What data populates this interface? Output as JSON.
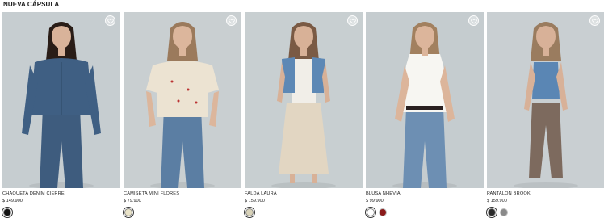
{
  "section": {
    "title": "NUEVA CÁPSULA"
  },
  "products": [
    {
      "name": "CHAQUETA DENIM CIERRE",
      "price": "$ 149.900",
      "image": {
        "bg": "#c6cdd0",
        "skin": "#d9b39a",
        "hair": "#2a1d17",
        "top": "#3f5f83",
        "bottom": "#3e5c7e",
        "top_style": "jacket",
        "bottom_style": "jeans"
      },
      "swatches": [
        {
          "color": "#111111",
          "selected": true
        }
      ]
    },
    {
      "name": "CAMISETA MINI FLORES",
      "price": "$ 79.900",
      "image": {
        "bg": "#c9cfd1",
        "skin": "#dcb69c",
        "hair": "#9b7a5c",
        "top": "#ece3d2",
        "bottom": "#5b7ea3",
        "top_style": "tee",
        "bottom_style": "jeans"
      },
      "swatches": [
        {
          "color": "#e9e3c8",
          "selected": true
        }
      ]
    },
    {
      "name": "FALDA LAURA",
      "price": "$ 159.900",
      "image": {
        "bg": "#c8cfd1",
        "skin": "#d8b197",
        "hair": "#7a5a44",
        "top": "#5d88b5",
        "bottom": "#e2d6c2",
        "top_style": "vest",
        "bottom_style": "skirt"
      },
      "swatches": [
        {
          "color": "#d8d2b8",
          "selected": true
        }
      ]
    },
    {
      "name": "BLUSA NHEVIA",
      "price": "$ 99.900",
      "image": {
        "bg": "#c5cccf",
        "skin": "#dcb59b",
        "hair": "#a2805f",
        "top": "#f7f6f2",
        "bottom": "#6d8fb3",
        "top_style": "sleeveless",
        "bottom_style": "jeans"
      },
      "swatches": [
        {
          "color": "#ffffff",
          "selected": true
        },
        {
          "color": "#8b1a1a",
          "selected": false
        }
      ]
    },
    {
      "name": "PANTALON BROOK",
      "price": "$ 159.900",
      "image": {
        "bg": "#c9cfd2",
        "skin": "#d8b198",
        "hair": "#9a7c5f",
        "top": "#5a86b4",
        "bottom": "#7d6a5e",
        "top_style": "tank",
        "bottom_style": "trousers"
      },
      "swatches": [
        {
          "color": "#2b2b2b",
          "selected": true
        },
        {
          "color": "#8a8a8a",
          "selected": false
        }
      ]
    }
  ],
  "icons": {
    "wishlist": "heart-icon"
  }
}
